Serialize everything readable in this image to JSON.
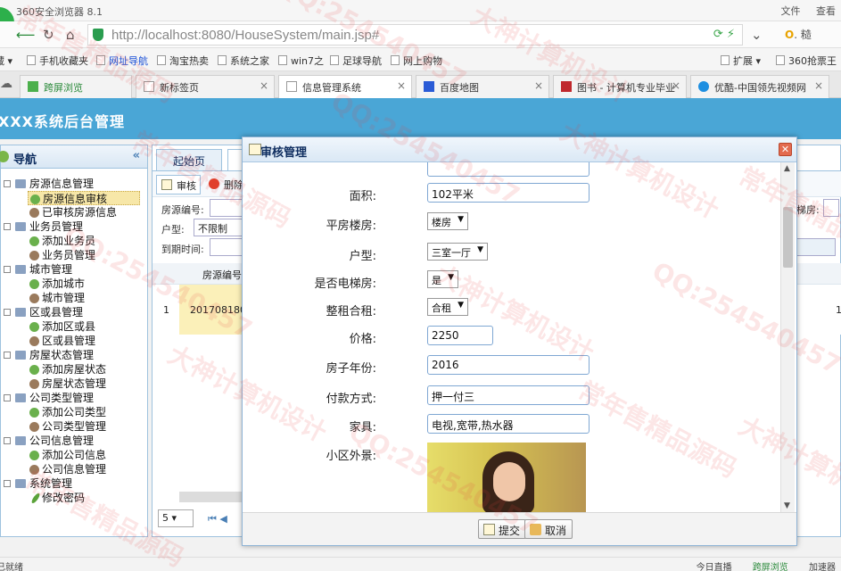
{
  "browser": {
    "title": "360安全浏览器 8.1",
    "menu_file": "文件",
    "menu_view": "查看",
    "url_host": "http://localhost",
    "url_rest": ":8080/HouseSystem/main.jsp#",
    "search_hint": "糙"
  },
  "bookmarks": [
    "手机收藏夹",
    "网址导航",
    "淘宝热卖",
    "系统之家",
    "win7之",
    "足球导航",
    "网上购物",
    "扩展",
    "360抢票王"
  ],
  "tabs": [
    {
      "label": "跨屏浏览"
    },
    {
      "label": "新标签页"
    },
    {
      "label": "信息管理系统"
    },
    {
      "label": "百度地图"
    },
    {
      "label": "图书 - 计算机专业毕业"
    },
    {
      "label": "优酷-中国领先视频网"
    }
  ],
  "app": {
    "title": "XXX系统后台管理"
  },
  "nav": {
    "title": "导航",
    "collapse": "«",
    "items": [
      {
        "type": "group",
        "label": "房源信息管理"
      },
      {
        "type": "leaf",
        "icon": "add",
        "label": "房源信息审核",
        "selected": true
      },
      {
        "type": "leaf",
        "icon": "user",
        "label": "已审核房源信息"
      },
      {
        "type": "group",
        "label": "业务员管理"
      },
      {
        "type": "leaf",
        "icon": "add",
        "label": "添加业务员"
      },
      {
        "type": "leaf",
        "icon": "user",
        "label": "业务员管理"
      },
      {
        "type": "group",
        "label": "城市管理"
      },
      {
        "type": "leaf",
        "icon": "add",
        "label": "添加城市"
      },
      {
        "type": "leaf",
        "icon": "user",
        "label": "城市管理"
      },
      {
        "type": "group",
        "label": "区或县管理"
      },
      {
        "type": "leaf",
        "icon": "add",
        "label": "添加区或县"
      },
      {
        "type": "leaf",
        "icon": "user",
        "label": "区或县管理"
      },
      {
        "type": "group",
        "label": "房屋状态管理"
      },
      {
        "type": "leaf",
        "icon": "add",
        "label": "添加房屋状态"
      },
      {
        "type": "leaf",
        "icon": "user",
        "label": "房屋状态管理"
      },
      {
        "type": "group",
        "label": "公司类型管理"
      },
      {
        "type": "leaf",
        "icon": "add",
        "label": "添加公司类型"
      },
      {
        "type": "leaf",
        "icon": "user",
        "label": "公司类型管理"
      },
      {
        "type": "group",
        "label": "公司信息管理"
      },
      {
        "type": "leaf",
        "icon": "add",
        "label": "添加公司信息"
      },
      {
        "type": "leaf",
        "icon": "user",
        "label": "公司信息管理"
      },
      {
        "type": "group",
        "label": "系统管理"
      },
      {
        "type": "leaf",
        "icon": "pen",
        "label": "修改密码"
      }
    ]
  },
  "main": {
    "tab_home": "起始页",
    "btn_audit": "审核",
    "btn_delete": "删除",
    "q_house_no": "房源编号:",
    "q_type": "户型:",
    "q_type_value": "不限制",
    "q_expire": "到期时间:",
    "q_elevator": "梯房:",
    "col_house_no": "房源编号",
    "row_num": "1",
    "row_house_no": "201708180",
    "row_right": "1",
    "page_size": "5"
  },
  "dialog": {
    "title": "审核管理",
    "close": "✕",
    "fields": [
      {
        "label": "面积:",
        "kind": "input",
        "value": "102平米",
        "w": 182
      },
      {
        "label": "平房楼房:",
        "kind": "select",
        "value": "楼房"
      },
      {
        "label": "户型:",
        "kind": "select",
        "value": "三室一厅"
      },
      {
        "label": "是否电梯房:",
        "kind": "select",
        "value": "是"
      },
      {
        "label": "整租合租:",
        "kind": "select",
        "value": "合租"
      },
      {
        "label": "价格:",
        "kind": "input",
        "value": "2250",
        "w": 74
      },
      {
        "label": "房子年份:",
        "kind": "input",
        "value": "2016",
        "w": 182
      },
      {
        "label": "付款方式:",
        "kind": "input",
        "value": "押一付三",
        "w": 182
      },
      {
        "label": "家具:",
        "kind": "input",
        "value": "电视,宽带,热水器",
        "w": 182
      },
      {
        "label": "小区外景:",
        "kind": "image"
      }
    ],
    "submit": "提交",
    "cancel": "取消"
  },
  "status": {
    "left": "已就绪",
    "live": "今日直播",
    "cross": "跨屏浏览",
    "speed": "加速器"
  },
  "watermarks": [
    "常年售精品源码",
    "QQ:254540457",
    "大神计算机设计"
  ]
}
